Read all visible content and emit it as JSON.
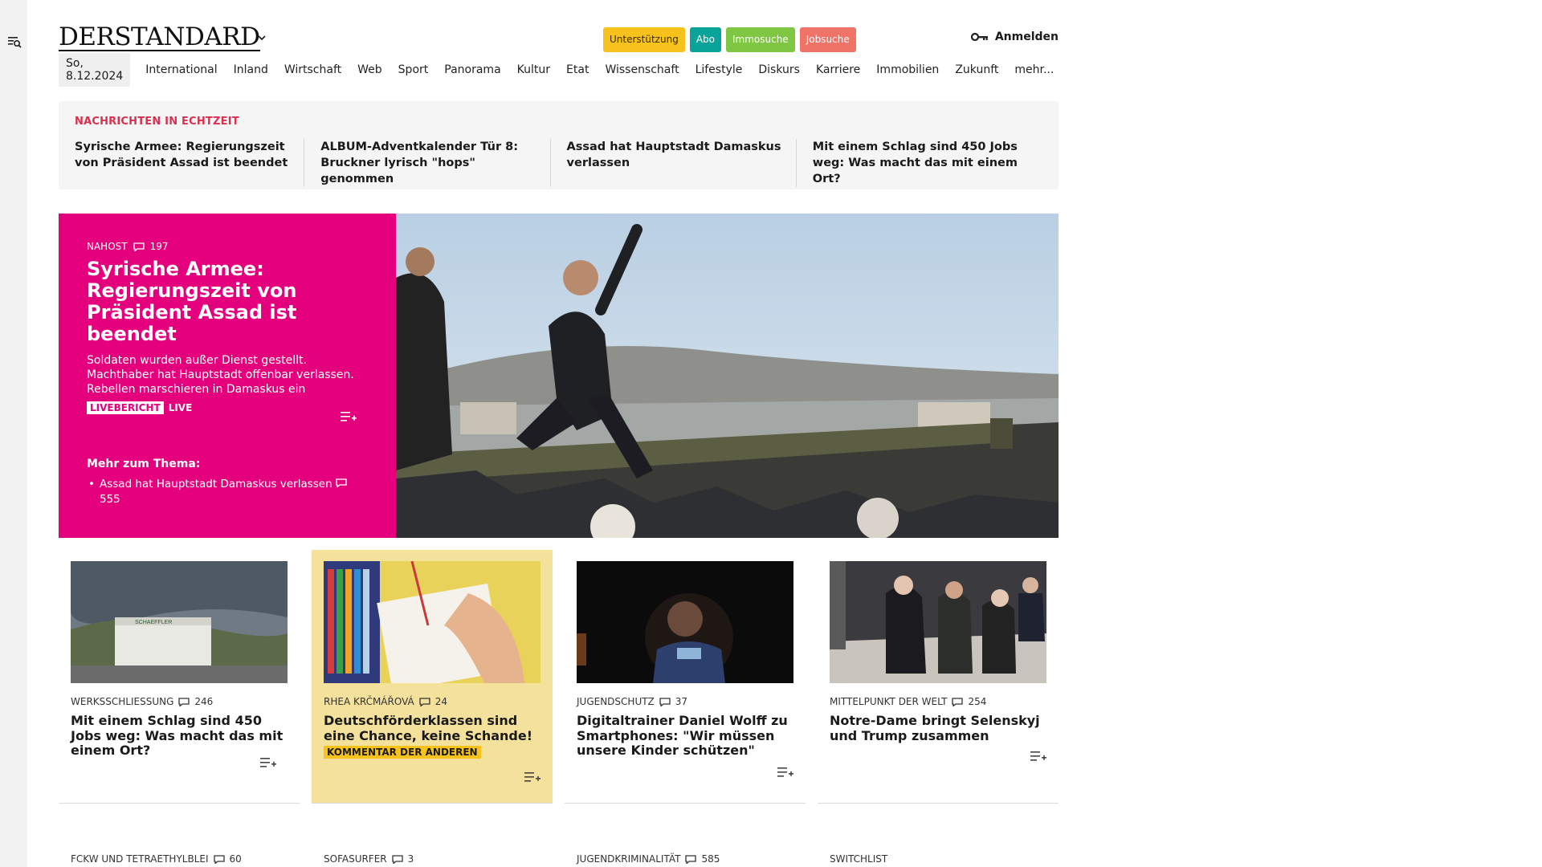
{
  "header": {
    "logo": "DERSTANDARD",
    "pills": [
      "Unterstützung",
      "Abo",
      "Immosuche",
      "Jobsuche"
    ],
    "login": "Anmelden"
  },
  "nav": {
    "date": "So, 8.12.2024",
    "items": [
      "International",
      "Inland",
      "Wirtschaft",
      "Web",
      "Sport",
      "Panorama",
      "Kultur",
      "Etat",
      "Wissenschaft",
      "Lifestyle",
      "Diskurs",
      "Karriere",
      "Immobilien",
      "Zukunft",
      "mehr..."
    ]
  },
  "ticker": {
    "label": "NACHRICHTEN IN ECHTZEIT",
    "items": [
      "Syrische Armee: Regierungszeit von Präsident Assad ist beendet",
      "ALBUM-Adventkalender Tür 8: Bruckner lyrisch \"hops\" genommen",
      "Assad hat Hauptstadt Damaskus verlassen",
      "Mit einem Schlag sind 450 Jobs weg: Was macht das mit einem Ort?"
    ]
  },
  "hero": {
    "kicker": "NAHOST",
    "comments": "197",
    "title": "Syrische Armee: Regierungszeit von Präsident Assad ist beendet",
    "subtitle": "Soldaten wurden außer Dienst gestellt. Machthaber hat Hauptstadt offenbar verlassen. Rebellen marschieren in Damaskus ein",
    "badge": "LIVEBERICHT",
    "live": "LIVE",
    "more_label": "Mehr zum Thema:",
    "more_item": "Assad hat Hauptstadt Damaskus verlassen",
    "more_comments": "555"
  },
  "cards": [
    {
      "kicker": "WERKSSCHLIESSUNG",
      "comments": "246",
      "title": "Mit einem Schlag sind 450 Jobs weg: Was macht das mit einem Ort?",
      "tag": ""
    },
    {
      "kicker": "RHEA KRČMÁŘOVÁ",
      "comments": "24",
      "title": "Deutschförderklassen sind eine Chance, keine Schande!",
      "tag": "KOMMENTAR DER ANDEREN"
    },
    {
      "kicker": "JUGENDSCHUTZ",
      "comments": "37",
      "title": "Digitaltrainer Daniel Wolff zu Smartphones: \"Wir müssen unsere Kinder schützen\"",
      "tag": ""
    },
    {
      "kicker": "MITTELPUNKT DER WELT",
      "comments": "254",
      "title": "Notre-Dame bringt Selenskyj und Trump zusammen",
      "tag": ""
    }
  ],
  "next_row": [
    {
      "kicker": "FCKW UND TETRAETHYLBLEI",
      "comments": "60"
    },
    {
      "kicker": "SOFASURFER",
      "comments": "3"
    },
    {
      "kicker": "JUGENDKRIMINALITÄT",
      "comments": "585"
    },
    {
      "kicker": "SWITCHLIST",
      "comments": ""
    }
  ],
  "colors": {
    "hero_bg": "#e4007c",
    "ticker_label": "#d9304f",
    "featured_card": "#f4e19b"
  }
}
